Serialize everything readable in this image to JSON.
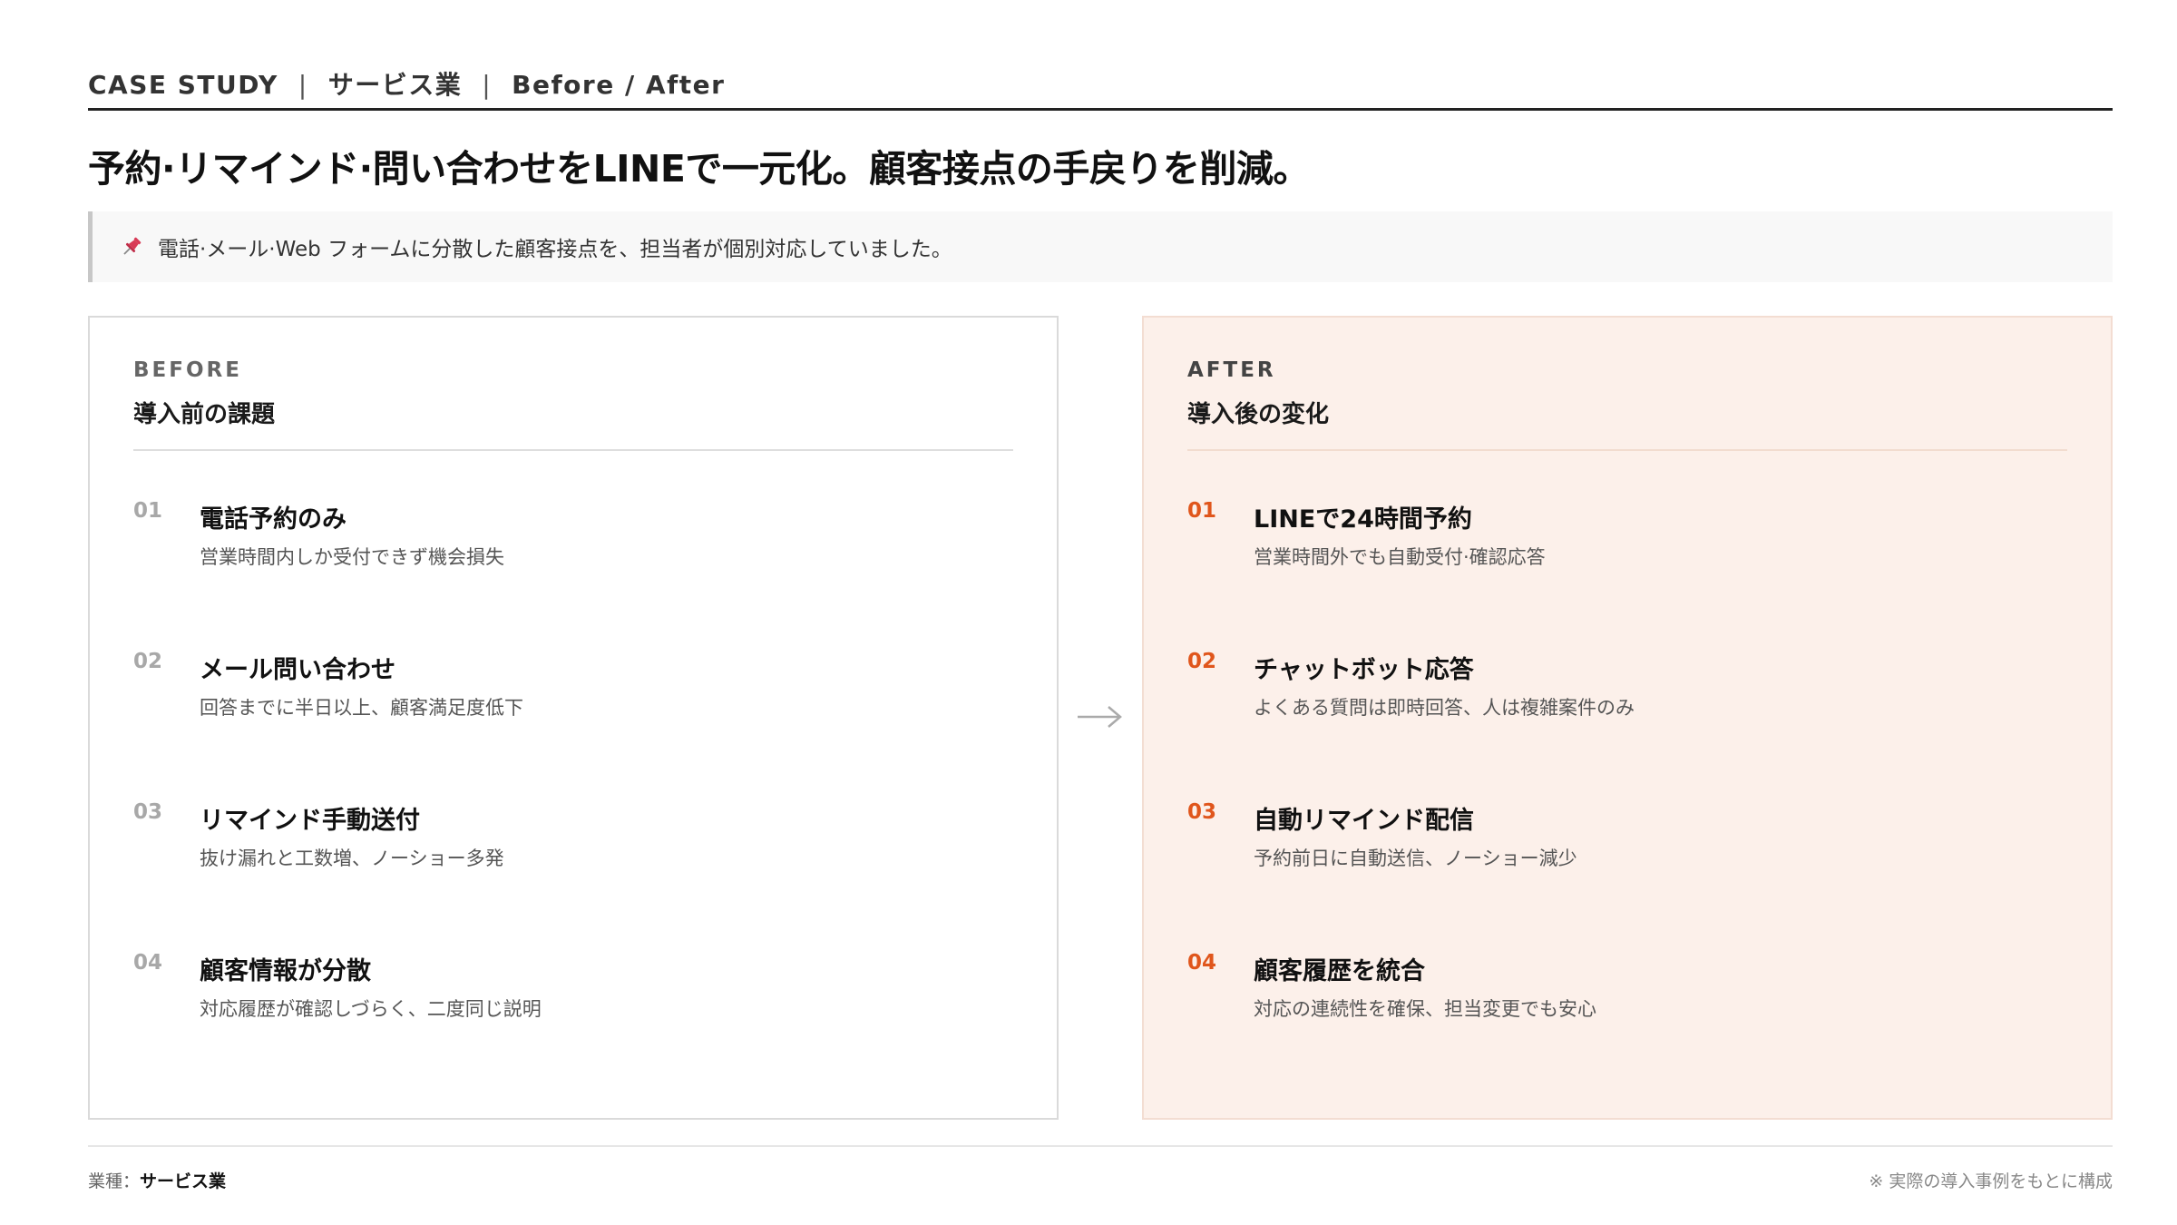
{
  "header": {
    "category": "CASE STUDY",
    "industry": "サービス業",
    "mode": "Before / After",
    "separator": "|"
  },
  "title": "予約·リマインド·問い合わせをLINEで一元化。顧客接点の手戻りを削減。",
  "note": {
    "icon": "pushpin-icon",
    "text": "電話·メール·Web フォームに分散した顧客接点を、担当者が個別対応していました。"
  },
  "before": {
    "eyebrow": "BEFORE",
    "heading": "導入前の課題",
    "items": [
      {
        "num": "01",
        "title": "電話予約のみ",
        "desc": "営業時間内しか受付できず機会損失"
      },
      {
        "num": "02",
        "title": "メール問い合わせ",
        "desc": "回答までに半日以上、顧客満足度低下"
      },
      {
        "num": "03",
        "title": "リマインド手動送付",
        "desc": "抜け漏れと工数増、ノーショー多発"
      },
      {
        "num": "04",
        "title": "顧客情報が分散",
        "desc": "対応履歴が確認しづらく、二度同じ説明"
      }
    ]
  },
  "after": {
    "eyebrow": "AFTER",
    "heading": "導入後の変化",
    "items": [
      {
        "num": "01",
        "title": "LINEで24時間予約",
        "desc": "営業時間外でも自動受付·確認応答"
      },
      {
        "num": "02",
        "title": "チャットボット応答",
        "desc": "よくある質問は即時回答、人は複雑案件のみ"
      },
      {
        "num": "03",
        "title": "自動リマインド配信",
        "desc": "予約前日に自動送信、ノーショー減少"
      },
      {
        "num": "04",
        "title": "顧客履歴を統合",
        "desc": "対応の連続性を確保、担当変更でも安心"
      }
    ]
  },
  "footer": {
    "industry_label": "業種：",
    "industry_value": "サービス業",
    "disclaimer": "※ 実際の導入事例をもとに構成"
  },
  "colors": {
    "accent": "#e0561c",
    "after_bg": "#fcf0ea",
    "pin": "#d83a56"
  }
}
